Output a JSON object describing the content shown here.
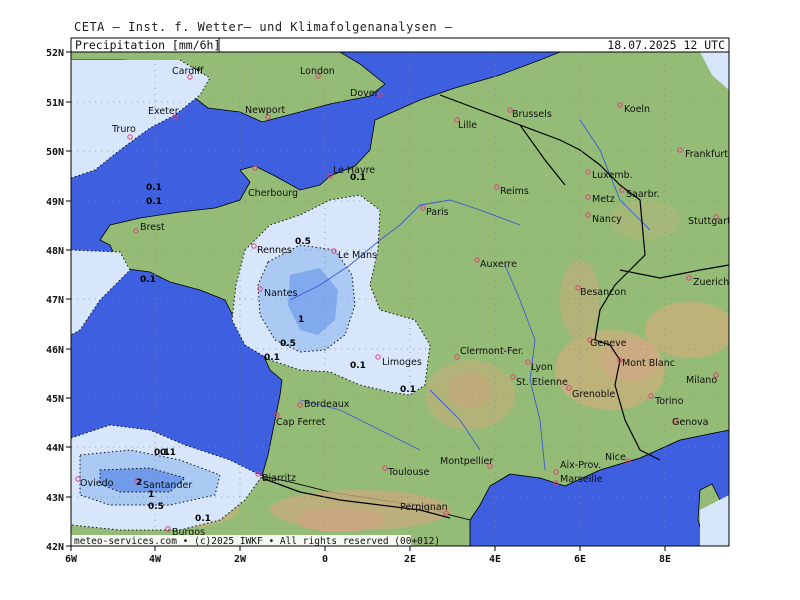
{
  "header": {
    "source": "CETA – Inst. f. Wetter– und Klimafolgenanalysen –",
    "parameter": "Precipitation [mm/6h]",
    "valid_time": "18.07.2025 12 UTC"
  },
  "footer": {
    "credit": "meteo-services.com • (c)2025 IWKF • All rights reserved (00+012)"
  },
  "axes": {
    "x_ticks": [
      "6W",
      "4W",
      "2W",
      "0",
      "2E",
      "4E",
      "6E",
      "8E"
    ],
    "y_ticks": [
      "52N",
      "51N",
      "50N",
      "49N",
      "48N",
      "47N",
      "46N",
      "45N",
      "44N",
      "43N",
      "42N"
    ]
  },
  "colors": {
    "sea": "#3d5fe0",
    "land": "#94bc76",
    "precip_light": "#d8e6fb",
    "precip_medium": "#aacaf3",
    "precip_heavy": "#6f9bea",
    "city_marker": "#e0407a"
  },
  "cities": [
    {
      "name": "Cardiff"
    },
    {
      "name": "London"
    },
    {
      "name": "Dover"
    },
    {
      "name": "Exeter"
    },
    {
      "name": "Newport"
    },
    {
      "name": "Truro"
    },
    {
      "name": "Brussels"
    },
    {
      "name": "Lille"
    },
    {
      "name": "Koeln"
    },
    {
      "name": "Frankfurt"
    },
    {
      "name": "Luxemb."
    },
    {
      "name": "Saarbr."
    },
    {
      "name": "Metz"
    },
    {
      "name": "Nancy"
    },
    {
      "name": "Stuttgart"
    },
    {
      "name": "Le Havre"
    },
    {
      "name": "Cherbourg"
    },
    {
      "name": "Reims"
    },
    {
      "name": "Paris"
    },
    {
      "name": "Brest"
    },
    {
      "name": "Rennes"
    },
    {
      "name": "Le Mans"
    },
    {
      "name": "Auxerre"
    },
    {
      "name": "Nantes"
    },
    {
      "name": "Besancon"
    },
    {
      "name": "Zuerich"
    },
    {
      "name": "Geneve"
    },
    {
      "name": "Mont Blanc"
    },
    {
      "name": "Limoges"
    },
    {
      "name": "Clermont-Fer."
    },
    {
      "name": "Lyon"
    },
    {
      "name": "St. Etienne"
    },
    {
      "name": "Grenoble"
    },
    {
      "name": "Milano"
    },
    {
      "name": "Torino"
    },
    {
      "name": "Bordeaux"
    },
    {
      "name": "Cap Ferret"
    },
    {
      "name": "Genova"
    },
    {
      "name": "Nice"
    },
    {
      "name": "Aix-Prov."
    },
    {
      "name": "Montpellier"
    },
    {
      "name": "Marseille"
    },
    {
      "name": "Toulouse"
    },
    {
      "name": "Biarritz"
    },
    {
      "name": "Oviedo"
    },
    {
      "name": "Santander"
    },
    {
      "name": "Perpignan"
    },
    {
      "name": "Burgos"
    }
  ],
  "contour_labels": [
    "0.1",
    "0.1",
    "0.1",
    "0.5",
    "0.1",
    "1",
    "0.5",
    "0.1",
    "0.1",
    "0.1",
    "0.1",
    "2",
    "1",
    "0.5",
    "0.1",
    "0.1"
  ]
}
